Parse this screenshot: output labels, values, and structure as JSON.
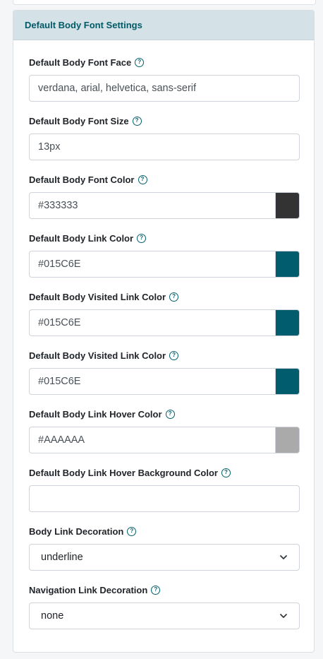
{
  "panel": {
    "title": "Default Body Font Settings"
  },
  "fields": {
    "font_face": {
      "label": "Default Body Font Face",
      "value": "verdana, arial, helvetica, sans-serif"
    },
    "font_size": {
      "label": "Default Body Font Size",
      "value": "13px"
    },
    "font_color": {
      "label": "Default Body Font Color",
      "value": "#333333",
      "swatch": "#333333"
    },
    "link_color": {
      "label": "Default Body Link Color",
      "value": "#015C6E",
      "swatch": "#015C6E"
    },
    "visited_link_color": {
      "label": "Default Body Visited Link Color",
      "value": "#015C6E",
      "swatch": "#015C6E"
    },
    "visited_link_color_2": {
      "label": "Default Body Visited Link Color",
      "value": "#015C6E",
      "swatch": "#015C6E"
    },
    "link_hover_color": {
      "label": "Default Body Link Hover Color",
      "value": "#AAAAAA",
      "swatch": "#AAAAAA"
    },
    "link_hover_bg": {
      "label": "Default Body Link Hover Background Color",
      "value": ""
    },
    "body_link_decoration": {
      "label": "Body Link Decoration",
      "selected": "underline"
    },
    "nav_link_decoration": {
      "label": "Navigation Link Decoration",
      "selected": "none"
    }
  },
  "icons": {
    "help": "question-circle-icon",
    "select": "chevron-down-icon"
  }
}
